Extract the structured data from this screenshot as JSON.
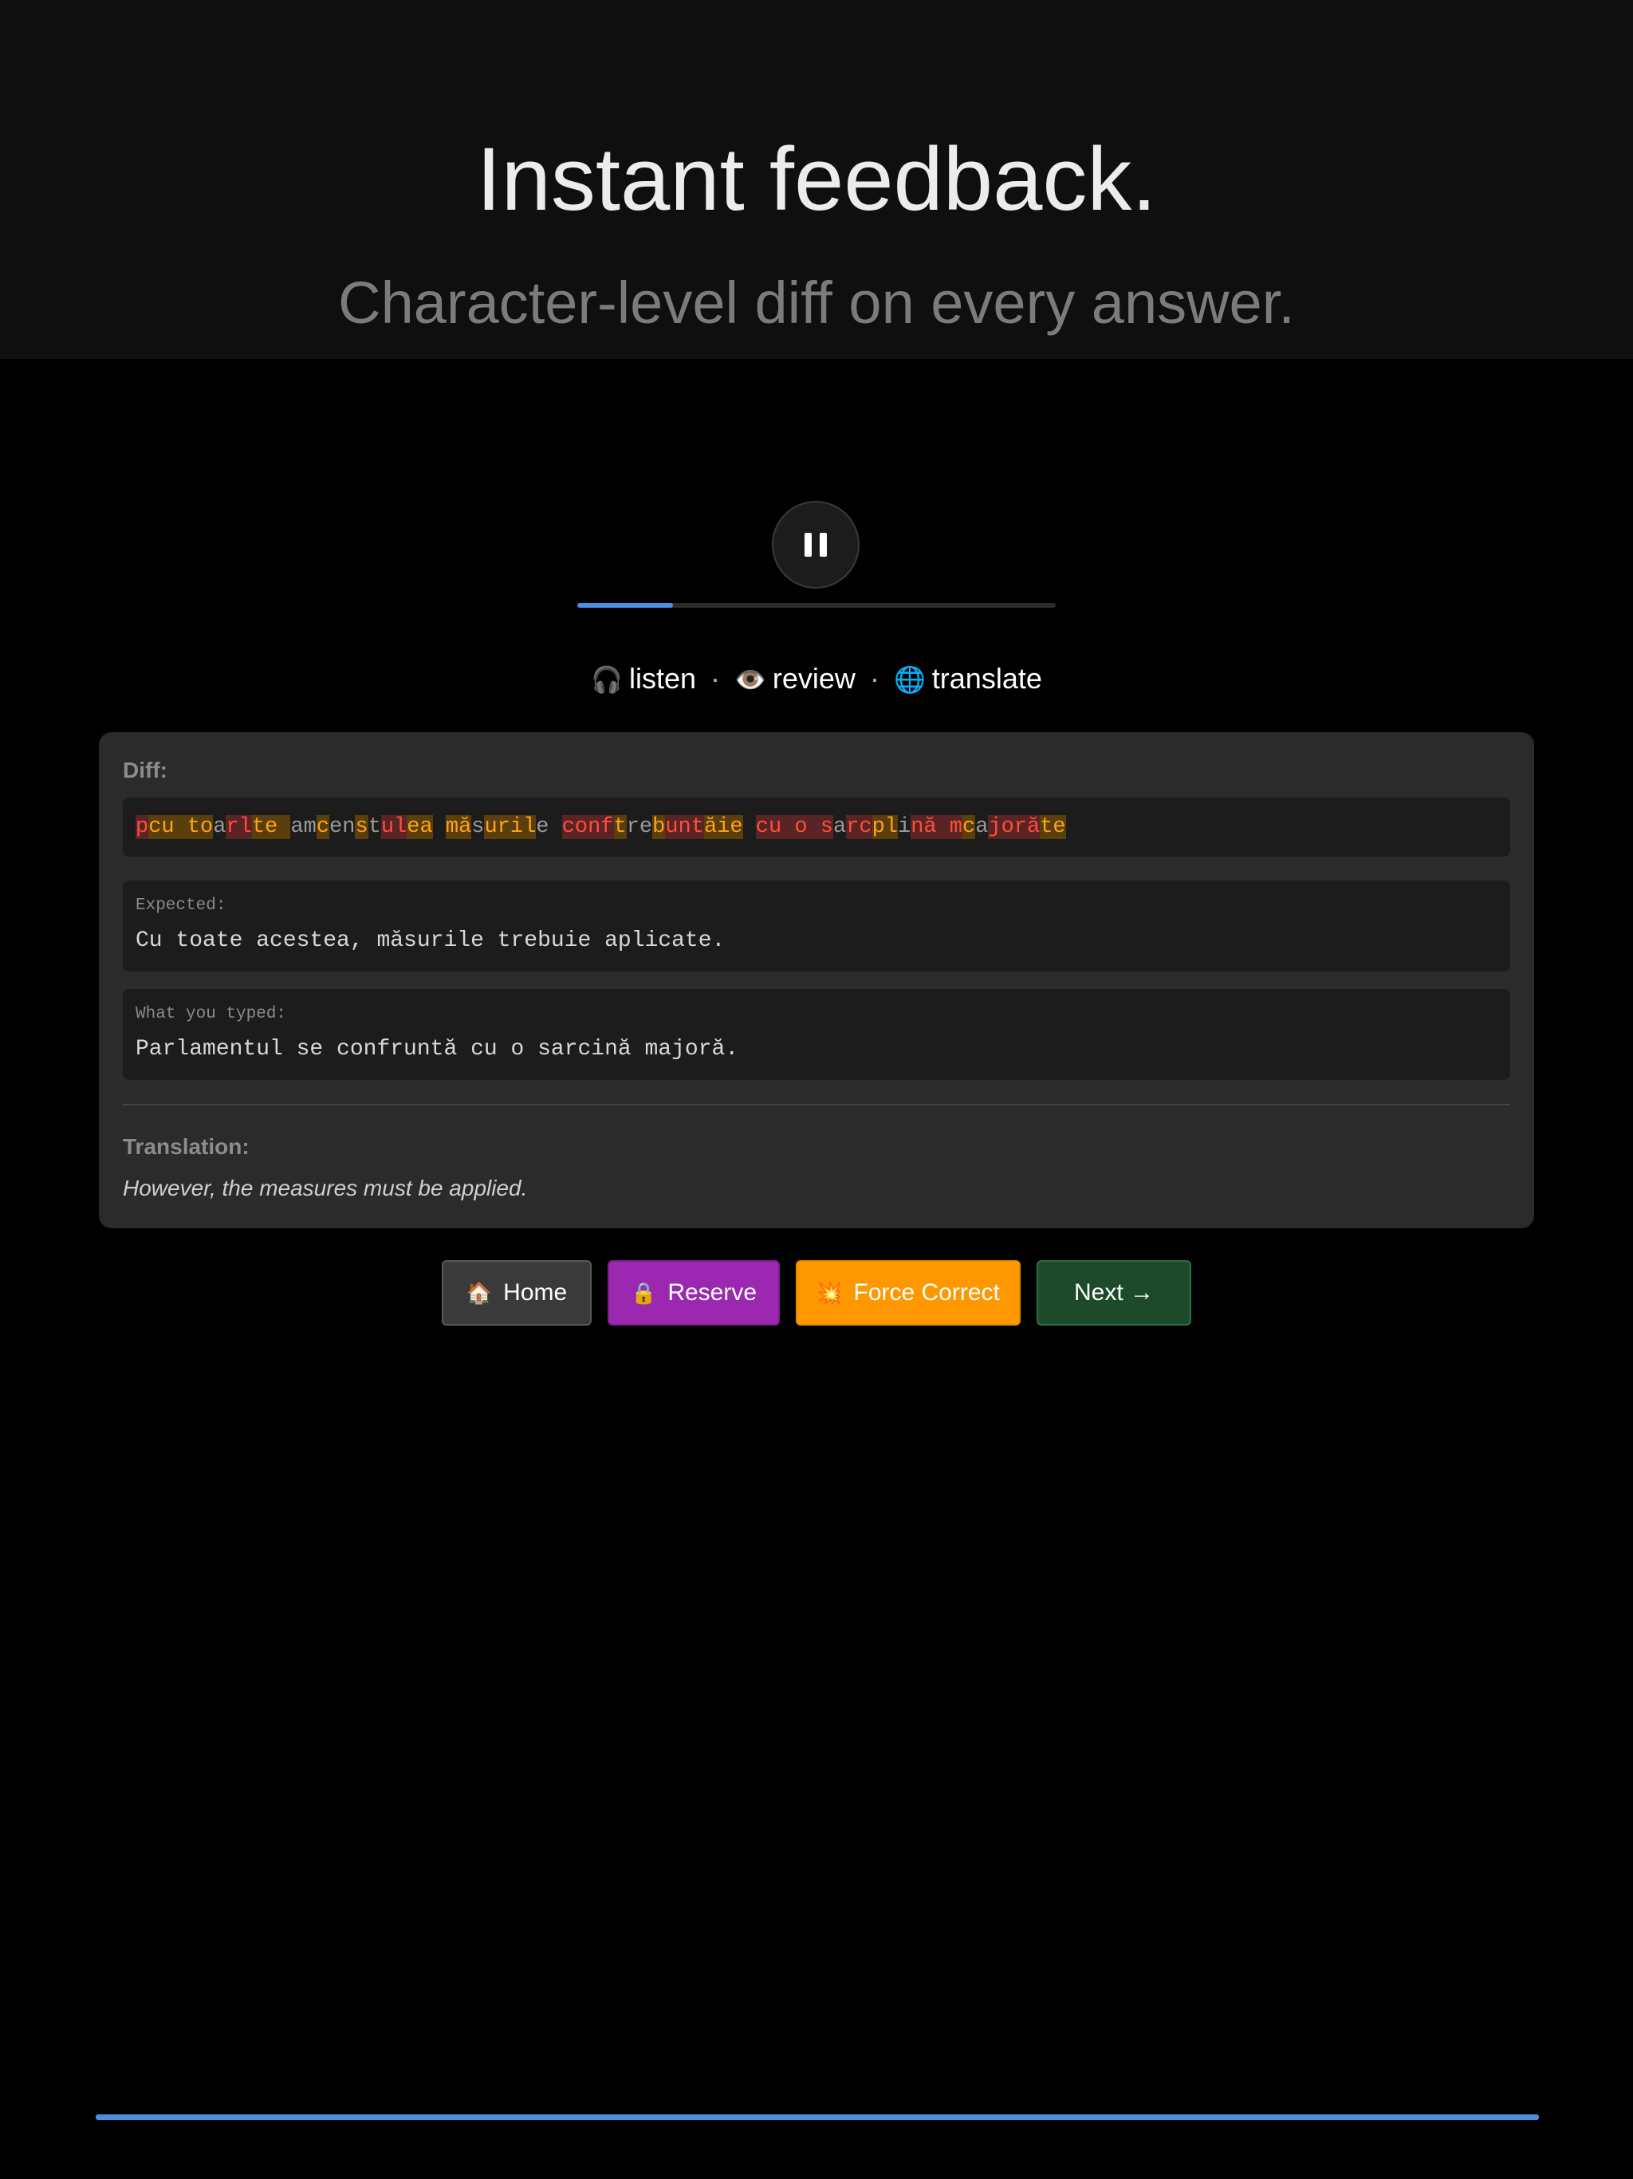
{
  "hero": {
    "title": "Instant feedback.",
    "subtitle": "Character-level diff on every answer."
  },
  "player": {
    "pause_icon": "pause-icon",
    "progress_fraction": 0.2,
    "progress_color": "#4a90e2"
  },
  "modes": {
    "listen": {
      "icon": "headphones-icon",
      "emoji": "🎧",
      "label": "listen"
    },
    "review": {
      "icon": "eye-icon",
      "emoji": "👁️",
      "label": "review"
    },
    "translate": {
      "icon": "globe-icon",
      "emoji": "🌐",
      "label": "translate"
    },
    "separator": "·"
  },
  "card": {
    "diff_label": "Diff:",
    "diff_segments": [
      {
        "t": "p",
        "k": "del"
      },
      {
        "t": "cu to",
        "k": "ins"
      },
      {
        "t": "a",
        "k": "ok"
      },
      {
        "t": "rl",
        "k": "del"
      },
      {
        "t": "te ",
        "k": "ins"
      },
      {
        "t": "am",
        "k": "ok"
      },
      {
        "t": "c",
        "k": "ins"
      },
      {
        "t": "en",
        "k": "ok"
      },
      {
        "t": "s",
        "k": "ins"
      },
      {
        "t": "t",
        "k": "ok"
      },
      {
        "t": "ul",
        "k": "del"
      },
      {
        "t": "ea",
        "k": "ins"
      },
      {
        "t": " ",
        "k": "ok"
      },
      {
        "t": "mă",
        "k": "ins"
      },
      {
        "t": "s",
        "k": "ok"
      },
      {
        "t": "uril",
        "k": "ins"
      },
      {
        "t": "e ",
        "k": "ok"
      },
      {
        "t": "conf",
        "k": "del"
      },
      {
        "t": "t",
        "k": "ins"
      },
      {
        "t": "re",
        "k": "ok"
      },
      {
        "t": "b",
        "k": "ins"
      },
      {
        "t": "unt",
        "k": "del"
      },
      {
        "t": "ăie",
        "k": "ins"
      },
      {
        "t": " ",
        "k": "ok"
      },
      {
        "t": "cu o s",
        "k": "del"
      },
      {
        "t": "a",
        "k": "ok"
      },
      {
        "t": "rc",
        "k": "del"
      },
      {
        "t": "pl",
        "k": "ins"
      },
      {
        "t": "i",
        "k": "ok"
      },
      {
        "t": "nă m",
        "k": "del"
      },
      {
        "t": "c",
        "k": "ins"
      },
      {
        "t": "a",
        "k": "ok"
      },
      {
        "t": "joră",
        "k": "del"
      },
      {
        "t": "te",
        "k": "ins"
      }
    ],
    "expected_label": "Expected:",
    "expected_text": "Cu toate acestea, măsurile trebuie aplicate.",
    "typed_label": "What you typed:",
    "typed_text": "Parlamentul se confruntă cu o sarcină majoră.",
    "translation_label": "Translation:",
    "translation_text": "However, the measures must be applied."
  },
  "actions": {
    "home": {
      "icon": "house-icon",
      "emoji": "🏠",
      "label": "Home"
    },
    "reserve": {
      "icon": "lock-icon",
      "emoji": "🔒",
      "label": "Reserve"
    },
    "force": {
      "icon": "collision-icon",
      "emoji": "💥",
      "label": "Force Correct"
    },
    "next": {
      "label": "Next →"
    }
  },
  "colors": {
    "accent": "#4a90e2",
    "reserve": "#9c27b0",
    "force": "#ff9800",
    "next": "#1e4a2c",
    "diff_removed": "#ff4d3d",
    "diff_added": "#ffa21a"
  }
}
